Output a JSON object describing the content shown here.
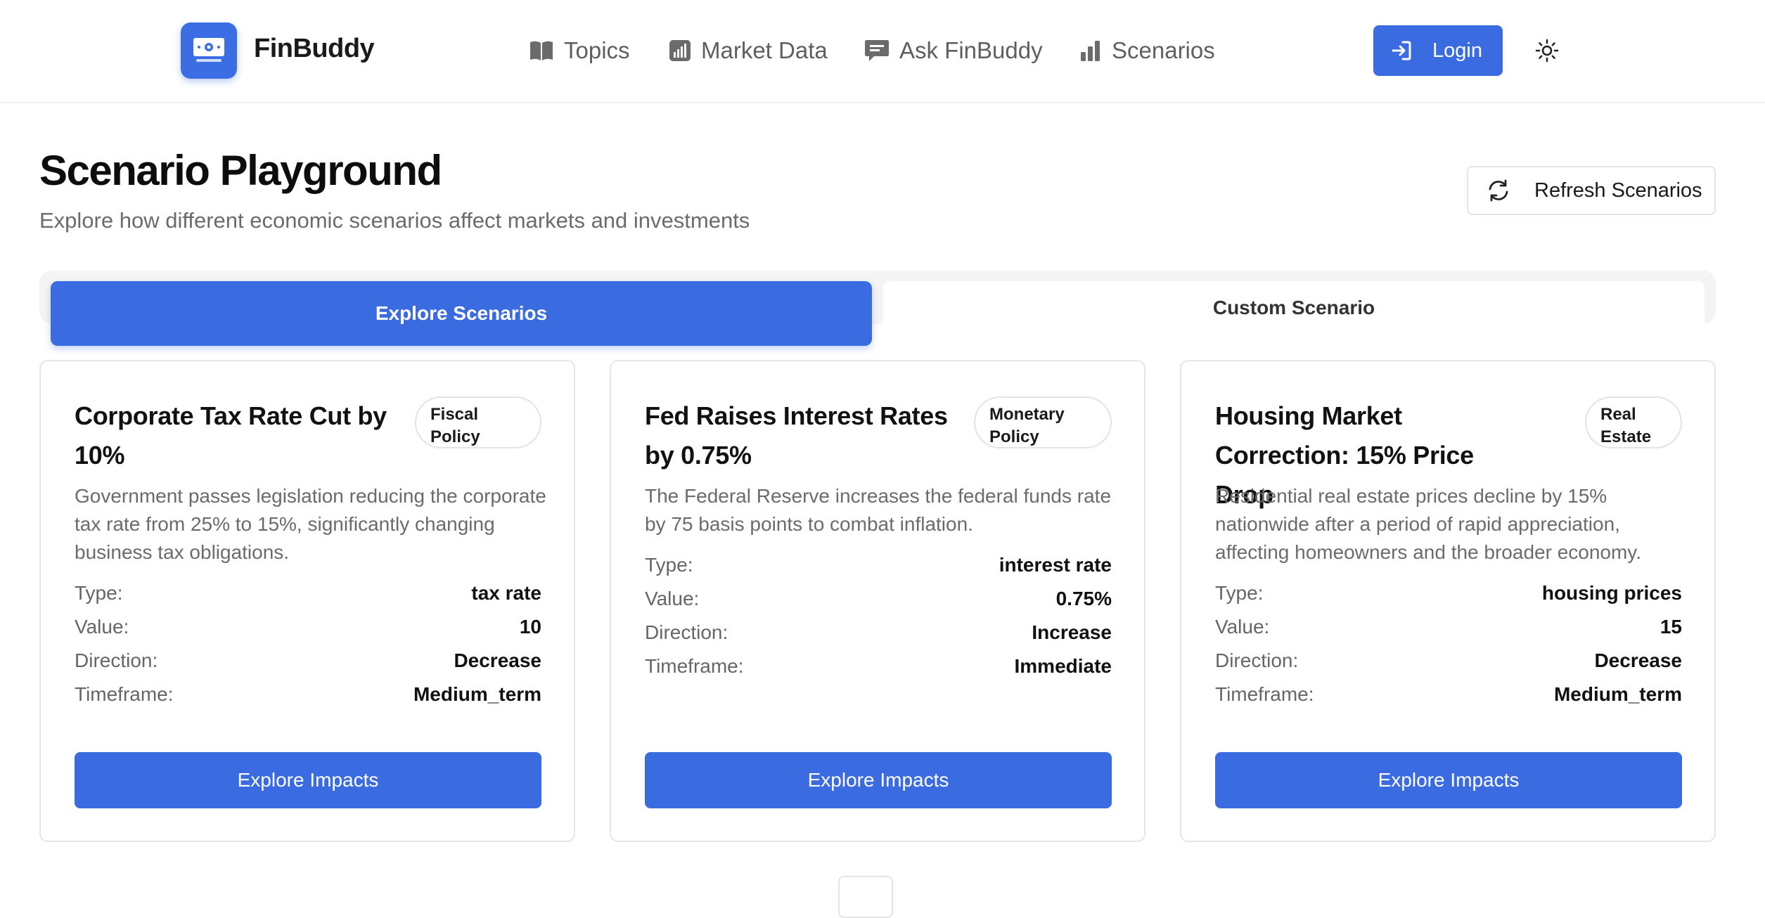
{
  "brand": {
    "name": "FinBuddy",
    "logo_icon": "banknote-icon",
    "accent": "#3a6be0"
  },
  "nav": [
    {
      "label": "Topics",
      "icon": "book-icon"
    },
    {
      "label": "Market Data",
      "icon": "chart-square-icon"
    },
    {
      "label": "Ask FinBuddy",
      "icon": "chat-icon"
    },
    {
      "label": "Scenarios",
      "icon": "bar-chart-icon"
    }
  ],
  "header": {
    "login_label": "Login",
    "theme_icon": "sun-icon"
  },
  "page": {
    "title": "Scenario Playground",
    "subtitle": "Explore how different economic scenarios affect markets and investments",
    "refresh_label": "Refresh Scenarios"
  },
  "tabs": [
    {
      "label": "Explore Scenarios",
      "active": true
    },
    {
      "label": "Custom Scenario",
      "active": false
    }
  ],
  "labels": {
    "type": "Type:",
    "value": "Value:",
    "direction": "Direction:",
    "timeframe": "Timeframe:"
  },
  "cards": [
    {
      "title": "Corporate Tax Rate Cut by 10%",
      "badge": "Fiscal Policy",
      "description": "Government passes legislation reducing the corporate tax rate from 25% to 15%, significantly changing business tax obligations.",
      "type": "tax rate",
      "value": "10",
      "direction": "Decrease",
      "timeframe": "Medium_term",
      "button": "Explore Impacts"
    },
    {
      "title": "Fed Raises Interest Rates by 0.75%",
      "badge": "Monetary Policy",
      "description": "The Federal Reserve increases the federal funds rate by 75 basis points to combat inflation.",
      "type": "interest rate",
      "value": "0.75%",
      "direction": "Increase",
      "timeframe": "Immediate",
      "button": "Explore Impacts"
    },
    {
      "title": "Housing Market Correction: 15% Price Drop",
      "badge": "Real Estate",
      "description": "Residential real estate prices decline by 15% nationwide after a period of rapid appreciation, affecting homeowners and the broader economy.",
      "type": "housing prices",
      "value": "15",
      "direction": "Decrease",
      "timeframe": "Medium_term",
      "button": "Explore Impacts"
    }
  ]
}
